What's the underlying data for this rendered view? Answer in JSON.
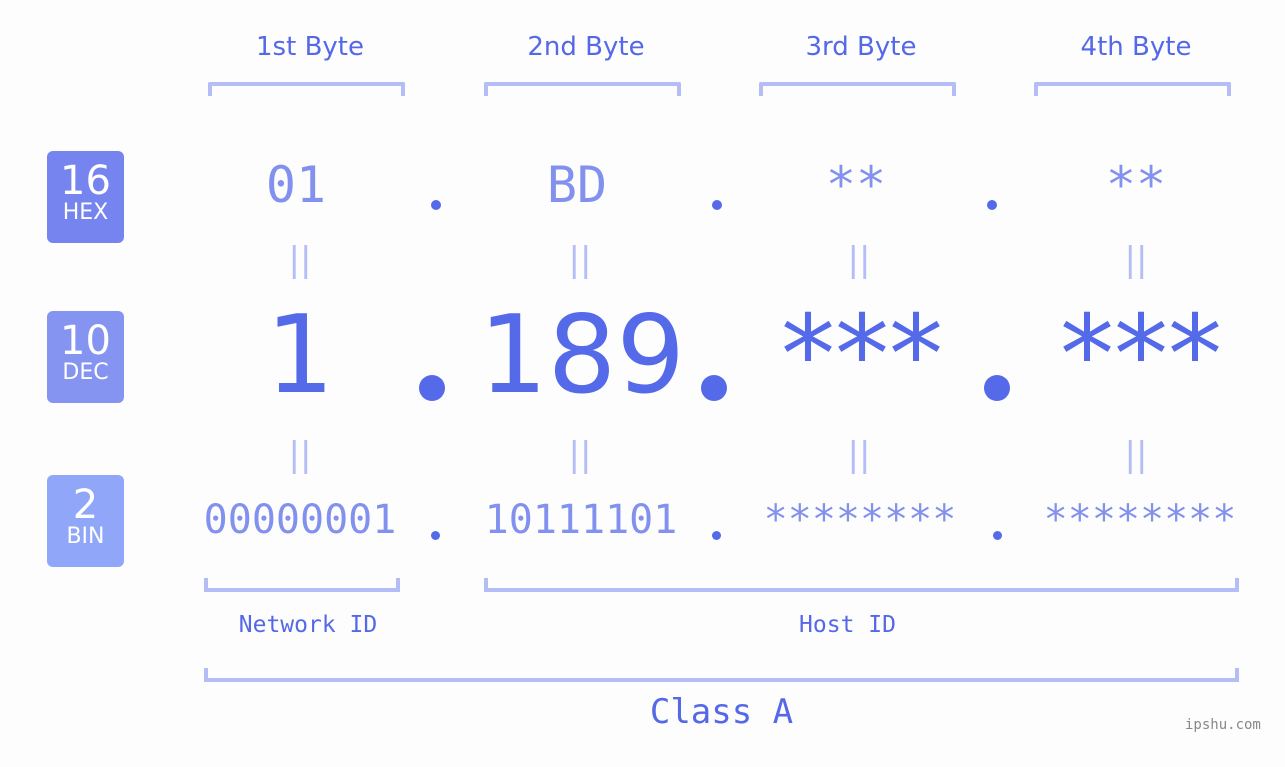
{
  "headers": [
    "1st Byte",
    "2nd Byte",
    "3rd Byte",
    "4th Byte"
  ],
  "badges": {
    "hex": {
      "num": "16",
      "label": "HEX",
      "color": "#7584ee"
    },
    "dec": {
      "num": "10",
      "label": "DEC",
      "color": "#8594f0"
    },
    "bin": {
      "num": "2",
      "label": "BIN",
      "color": "#90a6f8"
    }
  },
  "hex": [
    "01",
    "BD",
    "**",
    "**"
  ],
  "dec": [
    "1",
    "189",
    "***",
    "***"
  ],
  "bin": [
    "00000001",
    "10111101",
    "********",
    "********"
  ],
  "equals": "||",
  "labels": {
    "network": "Network ID",
    "host": "Host ID",
    "class": "Class A"
  },
  "watermark": "ipshu.com",
  "colors": {
    "accent": "#546ae9",
    "bracket": "#b4bdf6",
    "light_value": "#8391ee"
  }
}
